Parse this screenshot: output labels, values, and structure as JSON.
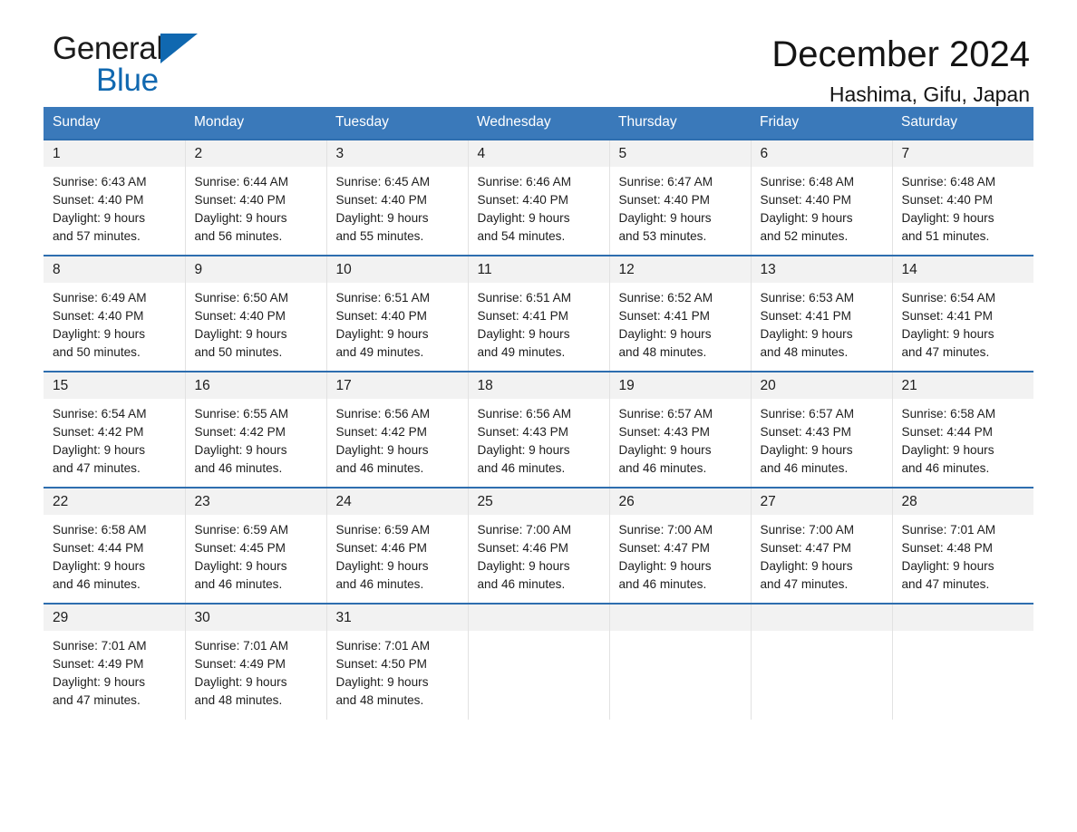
{
  "brand": {
    "name_part1": "General",
    "name_part2": "Blue",
    "triangle_icon": "triangle-icon",
    "accent_color": "#1068b0"
  },
  "header": {
    "title": "December 2024",
    "subtitle": "Hashima, Gifu, Japan"
  },
  "theme": {
    "header_row_bg": "#3a79ba",
    "week_divider": "#2e6eaf",
    "daynum_bg": "#f2f2f2",
    "text": "#1d1d1d"
  },
  "weekdays": [
    "Sunday",
    "Monday",
    "Tuesday",
    "Wednesday",
    "Thursday",
    "Friday",
    "Saturday"
  ],
  "weeks": [
    [
      {
        "day": "1",
        "sunrise": "Sunrise: 6:43 AM",
        "sunset": "Sunset: 4:40 PM",
        "daylight1": "Daylight: 9 hours",
        "daylight2": "and 57 minutes."
      },
      {
        "day": "2",
        "sunrise": "Sunrise: 6:44 AM",
        "sunset": "Sunset: 4:40 PM",
        "daylight1": "Daylight: 9 hours",
        "daylight2": "and 56 minutes."
      },
      {
        "day": "3",
        "sunrise": "Sunrise: 6:45 AM",
        "sunset": "Sunset: 4:40 PM",
        "daylight1": "Daylight: 9 hours",
        "daylight2": "and 55 minutes."
      },
      {
        "day": "4",
        "sunrise": "Sunrise: 6:46 AM",
        "sunset": "Sunset: 4:40 PM",
        "daylight1": "Daylight: 9 hours",
        "daylight2": "and 54 minutes."
      },
      {
        "day": "5",
        "sunrise": "Sunrise: 6:47 AM",
        "sunset": "Sunset: 4:40 PM",
        "daylight1": "Daylight: 9 hours",
        "daylight2": "and 53 minutes."
      },
      {
        "day": "6",
        "sunrise": "Sunrise: 6:48 AM",
        "sunset": "Sunset: 4:40 PM",
        "daylight1": "Daylight: 9 hours",
        "daylight2": "and 52 minutes."
      },
      {
        "day": "7",
        "sunrise": "Sunrise: 6:48 AM",
        "sunset": "Sunset: 4:40 PM",
        "daylight1": "Daylight: 9 hours",
        "daylight2": "and 51 minutes."
      }
    ],
    [
      {
        "day": "8",
        "sunrise": "Sunrise: 6:49 AM",
        "sunset": "Sunset: 4:40 PM",
        "daylight1": "Daylight: 9 hours",
        "daylight2": "and 50 minutes."
      },
      {
        "day": "9",
        "sunrise": "Sunrise: 6:50 AM",
        "sunset": "Sunset: 4:40 PM",
        "daylight1": "Daylight: 9 hours",
        "daylight2": "and 50 minutes."
      },
      {
        "day": "10",
        "sunrise": "Sunrise: 6:51 AM",
        "sunset": "Sunset: 4:40 PM",
        "daylight1": "Daylight: 9 hours",
        "daylight2": "and 49 minutes."
      },
      {
        "day": "11",
        "sunrise": "Sunrise: 6:51 AM",
        "sunset": "Sunset: 4:41 PM",
        "daylight1": "Daylight: 9 hours",
        "daylight2": "and 49 minutes."
      },
      {
        "day": "12",
        "sunrise": "Sunrise: 6:52 AM",
        "sunset": "Sunset: 4:41 PM",
        "daylight1": "Daylight: 9 hours",
        "daylight2": "and 48 minutes."
      },
      {
        "day": "13",
        "sunrise": "Sunrise: 6:53 AM",
        "sunset": "Sunset: 4:41 PM",
        "daylight1": "Daylight: 9 hours",
        "daylight2": "and 48 minutes."
      },
      {
        "day": "14",
        "sunrise": "Sunrise: 6:54 AM",
        "sunset": "Sunset: 4:41 PM",
        "daylight1": "Daylight: 9 hours",
        "daylight2": "and 47 minutes."
      }
    ],
    [
      {
        "day": "15",
        "sunrise": "Sunrise: 6:54 AM",
        "sunset": "Sunset: 4:42 PM",
        "daylight1": "Daylight: 9 hours",
        "daylight2": "and 47 minutes."
      },
      {
        "day": "16",
        "sunrise": "Sunrise: 6:55 AM",
        "sunset": "Sunset: 4:42 PM",
        "daylight1": "Daylight: 9 hours",
        "daylight2": "and 46 minutes."
      },
      {
        "day": "17",
        "sunrise": "Sunrise: 6:56 AM",
        "sunset": "Sunset: 4:42 PM",
        "daylight1": "Daylight: 9 hours",
        "daylight2": "and 46 minutes."
      },
      {
        "day": "18",
        "sunrise": "Sunrise: 6:56 AM",
        "sunset": "Sunset: 4:43 PM",
        "daylight1": "Daylight: 9 hours",
        "daylight2": "and 46 minutes."
      },
      {
        "day": "19",
        "sunrise": "Sunrise: 6:57 AM",
        "sunset": "Sunset: 4:43 PM",
        "daylight1": "Daylight: 9 hours",
        "daylight2": "and 46 minutes."
      },
      {
        "day": "20",
        "sunrise": "Sunrise: 6:57 AM",
        "sunset": "Sunset: 4:43 PM",
        "daylight1": "Daylight: 9 hours",
        "daylight2": "and 46 minutes."
      },
      {
        "day": "21",
        "sunrise": "Sunrise: 6:58 AM",
        "sunset": "Sunset: 4:44 PM",
        "daylight1": "Daylight: 9 hours",
        "daylight2": "and 46 minutes."
      }
    ],
    [
      {
        "day": "22",
        "sunrise": "Sunrise: 6:58 AM",
        "sunset": "Sunset: 4:44 PM",
        "daylight1": "Daylight: 9 hours",
        "daylight2": "and 46 minutes."
      },
      {
        "day": "23",
        "sunrise": "Sunrise: 6:59 AM",
        "sunset": "Sunset: 4:45 PM",
        "daylight1": "Daylight: 9 hours",
        "daylight2": "and 46 minutes."
      },
      {
        "day": "24",
        "sunrise": "Sunrise: 6:59 AM",
        "sunset": "Sunset: 4:46 PM",
        "daylight1": "Daylight: 9 hours",
        "daylight2": "and 46 minutes."
      },
      {
        "day": "25",
        "sunrise": "Sunrise: 7:00 AM",
        "sunset": "Sunset: 4:46 PM",
        "daylight1": "Daylight: 9 hours",
        "daylight2": "and 46 minutes."
      },
      {
        "day": "26",
        "sunrise": "Sunrise: 7:00 AM",
        "sunset": "Sunset: 4:47 PM",
        "daylight1": "Daylight: 9 hours",
        "daylight2": "and 46 minutes."
      },
      {
        "day": "27",
        "sunrise": "Sunrise: 7:00 AM",
        "sunset": "Sunset: 4:47 PM",
        "daylight1": "Daylight: 9 hours",
        "daylight2": "and 47 minutes."
      },
      {
        "day": "28",
        "sunrise": "Sunrise: 7:01 AM",
        "sunset": "Sunset: 4:48 PM",
        "daylight1": "Daylight: 9 hours",
        "daylight2": "and 47 minutes."
      }
    ],
    [
      {
        "day": "29",
        "sunrise": "Sunrise: 7:01 AM",
        "sunset": "Sunset: 4:49 PM",
        "daylight1": "Daylight: 9 hours",
        "daylight2": "and 47 minutes."
      },
      {
        "day": "30",
        "sunrise": "Sunrise: 7:01 AM",
        "sunset": "Sunset: 4:49 PM",
        "daylight1": "Daylight: 9 hours",
        "daylight2": "and 48 minutes."
      },
      {
        "day": "31",
        "sunrise": "Sunrise: 7:01 AM",
        "sunset": "Sunset: 4:50 PM",
        "daylight1": "Daylight: 9 hours",
        "daylight2": "and 48 minutes."
      },
      {
        "day": "",
        "sunrise": "",
        "sunset": "",
        "daylight1": "",
        "daylight2": ""
      },
      {
        "day": "",
        "sunrise": "",
        "sunset": "",
        "daylight1": "",
        "daylight2": ""
      },
      {
        "day": "",
        "sunrise": "",
        "sunset": "",
        "daylight1": "",
        "daylight2": ""
      },
      {
        "day": "",
        "sunrise": "",
        "sunset": "",
        "daylight1": "",
        "daylight2": ""
      }
    ]
  ]
}
